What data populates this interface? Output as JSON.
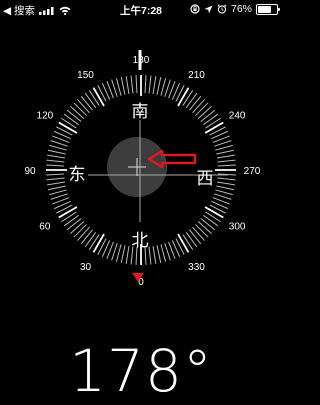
{
  "status_bar": {
    "back_label": "◀ 搜索",
    "time": "上午7:28",
    "battery_percent": "76%",
    "battery_level": 0.76,
    "icons": [
      "back-arrow-icon",
      "signal-bars-icon",
      "wifi-icon",
      "screen-lock-icon",
      "location-arrow-icon",
      "alarm-icon",
      "battery-icon"
    ]
  },
  "compass": {
    "degree_labels": [
      "0",
      "30",
      "60",
      "90",
      "120",
      "150",
      "180",
      "210",
      "240",
      "270",
      "300",
      "330"
    ],
    "cardinals": {
      "north": "北",
      "east": "东",
      "south": "南",
      "west": "西"
    },
    "arrow_color": "#e0191d",
    "north_marker_color": "#e0191d"
  },
  "heading": {
    "value": "178°"
  }
}
